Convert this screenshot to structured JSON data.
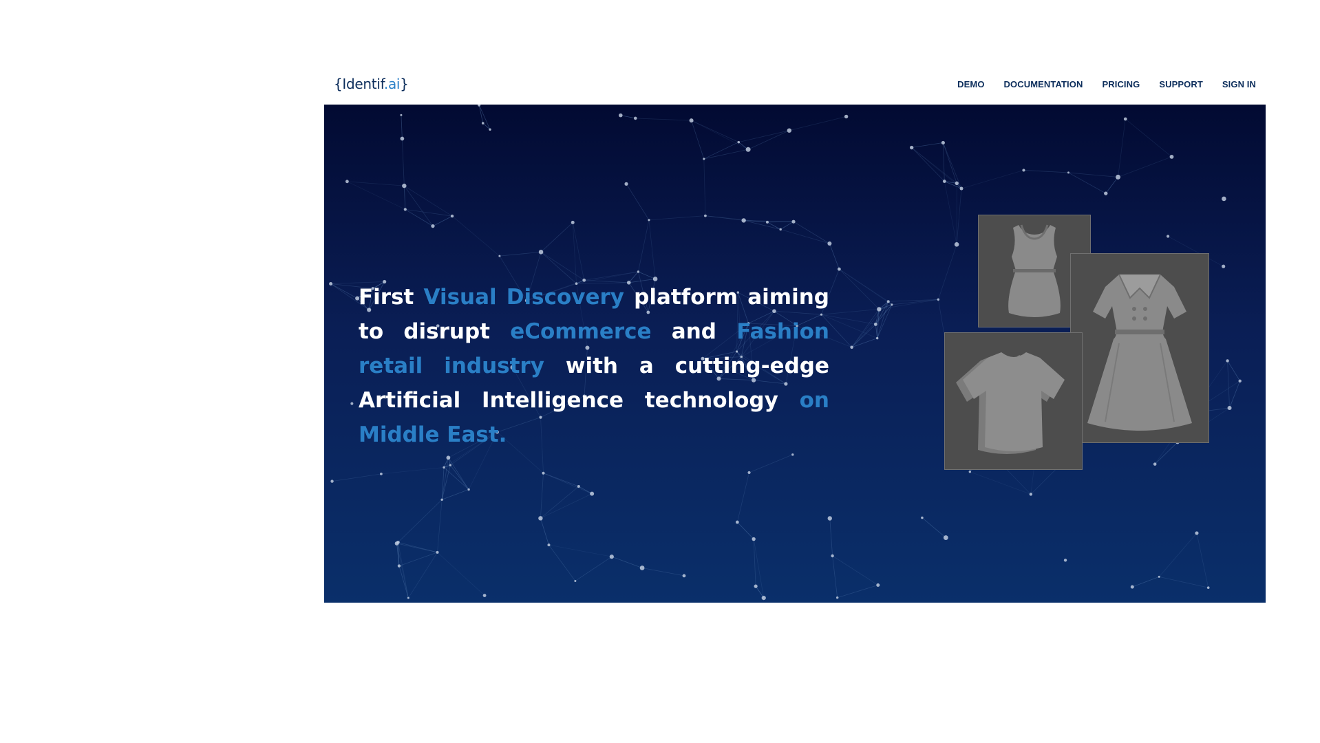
{
  "brand": {
    "open": "{Identif",
    "dot": ".ai",
    "close": "}"
  },
  "nav": [
    "DEMO",
    "DOCUMENTATION",
    "PRICING",
    "SUPPORT",
    "SIGN IN"
  ],
  "hero": {
    "segments": [
      {
        "text": "First ",
        "highlight": false
      },
      {
        "text": "Visual Discovery",
        "highlight": true
      },
      {
        "text": " platform aiming to disrupt ",
        "highlight": false
      },
      {
        "text": "eCommerce",
        "highlight": true
      },
      {
        "text": " and ",
        "highlight": false
      },
      {
        "text": "Fashion retail industry",
        "highlight": true
      },
      {
        "text": " with a cutting-edge Artificial Intelligence technology ",
        "highlight": false
      },
      {
        "text": "on Middle East.",
        "highlight": true
      }
    ]
  },
  "colors": {
    "brand_navy": "#0d2e5c",
    "accent_blue": "#2a7fc6",
    "hero_top": "#020a32",
    "hero_bottom": "#0a2f6a",
    "card_gray": "#4d4d4d",
    "garment_gray": "#8a8a8a"
  },
  "icons": [
    "sleeveless-top-icon",
    "dress-icon",
    "tshirt-icon"
  ]
}
